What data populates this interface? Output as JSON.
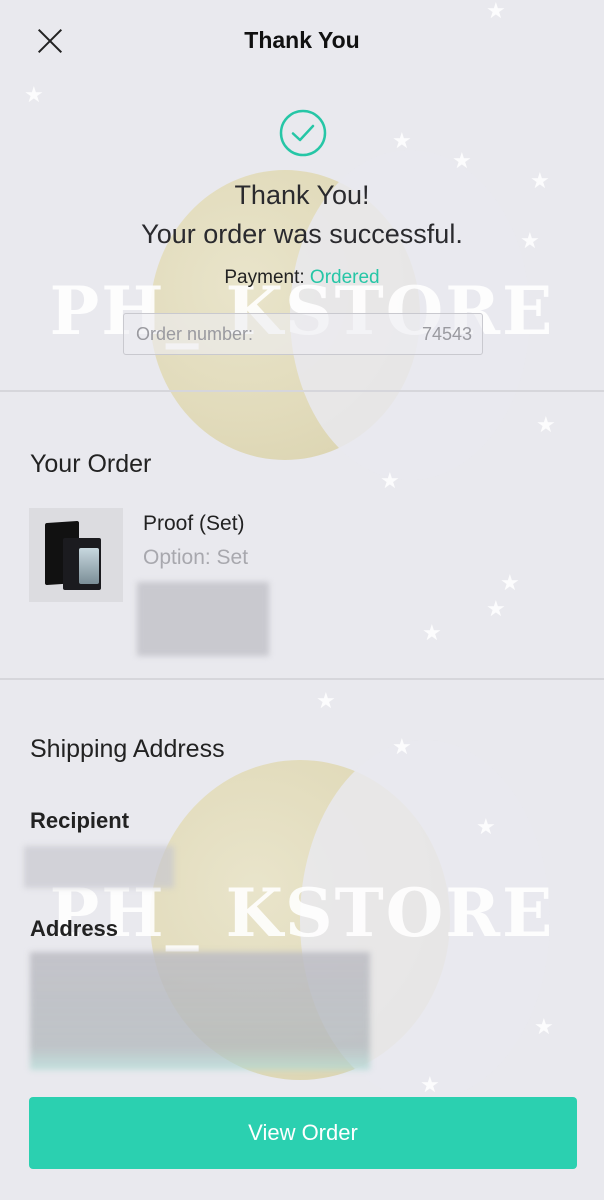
{
  "header": {
    "title": "Thank You",
    "close_icon": "close-icon"
  },
  "confirmation": {
    "icon": "check-circle-icon",
    "line1": "Thank You!",
    "line2": "Your order was successful.",
    "payment_label": "Payment:",
    "payment_status": "Ordered",
    "order_number_label": "Order number:",
    "order_number_value": "74543"
  },
  "watermark": "PH_ KSTORE",
  "your_order": {
    "heading": "Your Order",
    "items": [
      {
        "name": "Proof (Set)",
        "option": "Option: Set"
      }
    ]
  },
  "shipping": {
    "heading": "Shipping Address",
    "recipient_label": "Recipient",
    "address_label": "Address"
  },
  "actions": {
    "view_order_label": "View Order"
  },
  "colors": {
    "accent": "#2bd0b0",
    "status_text": "#26c6a6",
    "background": "#e9e9ee"
  }
}
